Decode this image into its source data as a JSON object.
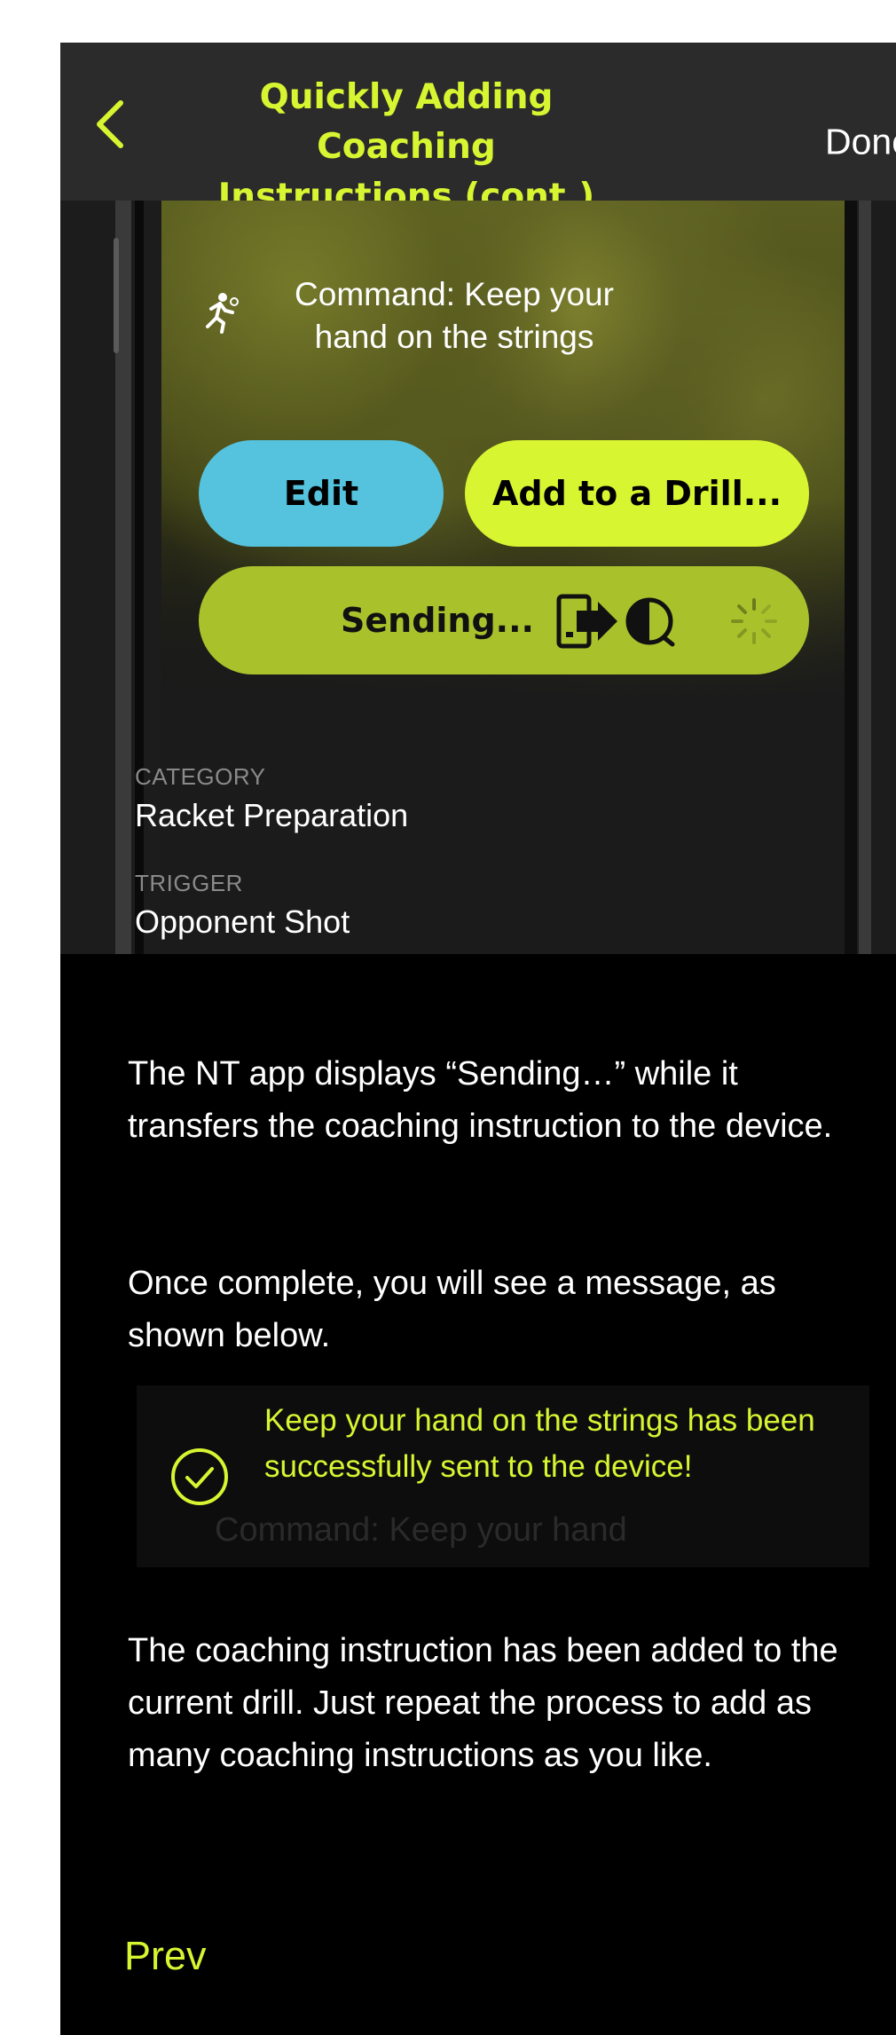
{
  "header": {
    "title_line1": "Quickly Adding Coaching",
    "title_line2": "Instructions (cont.)",
    "done_label": "Done"
  },
  "screenshot": {
    "command_text": "Command: Keep your hand on the strings",
    "edit_label": "Edit",
    "add_label": "Add to a Drill...",
    "sending_label": "Sending...",
    "category_label": "CATEGORY",
    "category_value": "Racket Preparation",
    "trigger_label": "TRIGGER",
    "trigger_value": "Opponent Shot"
  },
  "body": {
    "paragraph1": "The NT app displays “Sending…” while it transfers the coaching instruction to the device.",
    "paragraph2": "Once complete, you will see a message, as shown below.",
    "paragraph3": "The coaching instruction has been added to the current drill. Just repeat the process to add as many coaching instructions as you like."
  },
  "toast": {
    "message": "Keep your hand on the strings has been successfully sent to the device!",
    "background_text": "Command: Keep your hand"
  },
  "footer": {
    "prev_label": "Prev"
  },
  "colors": {
    "accent": "#d8f531",
    "edit_button": "#55c3dd",
    "sending_button": "#a9c22c",
    "navbar": "#2b2b2b"
  }
}
